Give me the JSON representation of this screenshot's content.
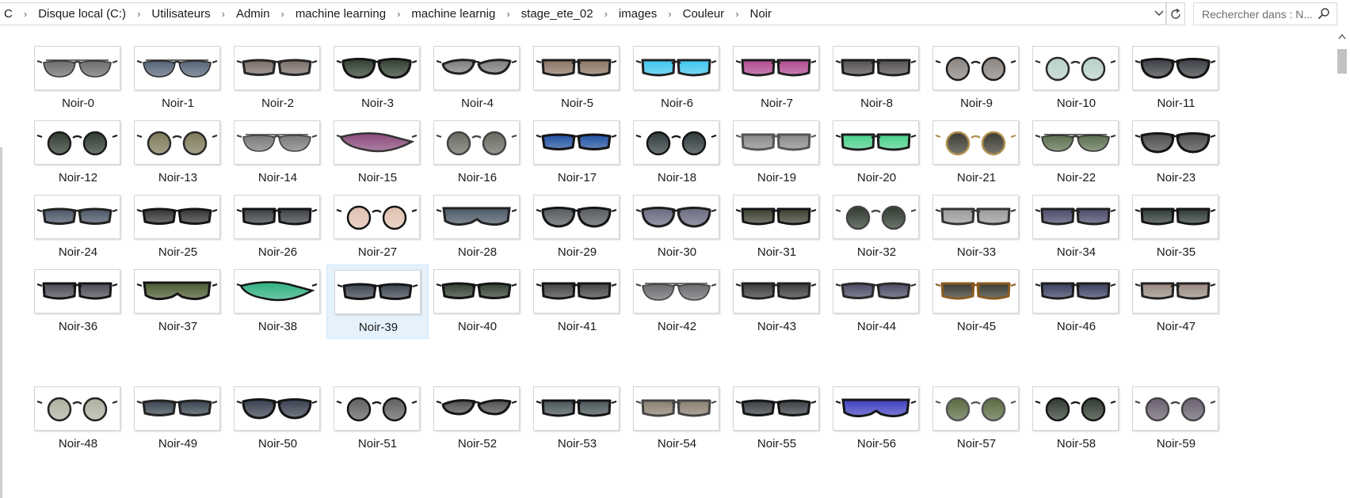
{
  "address_bar": {
    "breadcrumbs": [
      "C",
      "Disque local (C:)",
      "Utilisateurs",
      "Admin",
      "machine learning",
      "machine learnig",
      "stage_ete_02",
      "images",
      "Couleur",
      "Noir"
    ]
  },
  "search": {
    "placeholder": "Rechercher dans : N..."
  },
  "icons": {
    "dropdown": "chevron-down-icon",
    "refresh": "refresh-icon",
    "search": "search-icon",
    "separator": "chevron-right-icon",
    "scroll_up": "caret-up-icon"
  },
  "selected_file": "Noir-39",
  "files": [
    {
      "name": "Noir-0",
      "lens": "#6d6d6d",
      "frame": "#3a3a3a",
      "style": "aviator"
    },
    {
      "name": "Noir-1",
      "lens": "#556577",
      "frame": "#2c2c2c",
      "style": "aviator"
    },
    {
      "name": "Noir-2",
      "lens": "#7a6d68",
      "frame": "#262626",
      "style": "wrap"
    },
    {
      "name": "Noir-3",
      "lens": "#2f3f2f",
      "frame": "#151515",
      "style": "cat"
    },
    {
      "name": "Noir-4",
      "lens": "#7d7d7d",
      "frame": "#222222",
      "style": "cateye"
    },
    {
      "name": "Noir-5",
      "lens": "#8a7565",
      "frame": "#1e1e1e",
      "style": "square"
    },
    {
      "name": "Noir-6",
      "lens": "#3fc6f0",
      "frame": "#202020",
      "style": "square"
    },
    {
      "name": "Noir-7",
      "lens": "#b04a90",
      "frame": "#1e1e1e",
      "style": "square"
    },
    {
      "name": "Noir-8",
      "lens": "#555050",
      "frame": "#1e1e1e",
      "style": "square"
    },
    {
      "name": "Noir-9",
      "lens": "#8a8480",
      "frame": "#1e1e1e",
      "style": "round"
    },
    {
      "name": "Noir-10",
      "lens": "#b8d0c8",
      "frame": "#2a2a2a",
      "style": "round"
    },
    {
      "name": "Noir-11",
      "lens": "#3b3f44",
      "frame": "#151515",
      "style": "cat"
    },
    {
      "name": "Noir-12",
      "lens": "#2f3a2f",
      "frame": "#1b1b1b",
      "style": "round"
    },
    {
      "name": "Noir-13",
      "lens": "#7e7a5a",
      "frame": "#2a2a2a",
      "style": "round"
    },
    {
      "name": "Noir-14",
      "lens": "#7a7a7a",
      "frame": "#444444",
      "style": "aviator"
    },
    {
      "name": "Noir-15",
      "lens": "#8a4a7a",
      "frame": "#333333",
      "style": "sport"
    },
    {
      "name": "Noir-16",
      "lens": "#6a6a62",
      "frame": "#444444",
      "style": "round"
    },
    {
      "name": "Noir-17",
      "lens": "#2050a0",
      "frame": "#151515",
      "style": "wrap"
    },
    {
      "name": "Noir-18",
      "lens": "#2e3a3c",
      "frame": "#151515",
      "style": "round"
    },
    {
      "name": "Noir-19",
      "lens": "#8a8a8a",
      "frame": "#555555",
      "style": "square"
    },
    {
      "name": "Noir-20",
      "lens": "#4ad08a",
      "frame": "#1e1e1e",
      "style": "square"
    },
    {
      "name": "Noir-21",
      "lens": "#3a3a30",
      "frame": "#b09050",
      "style": "round"
    },
    {
      "name": "Noir-22",
      "lens": "#5a7050",
      "frame": "#333333",
      "style": "aviator"
    },
    {
      "name": "Noir-23",
      "lens": "#4a4a4a",
      "frame": "#151515",
      "style": "cat"
    },
    {
      "name": "Noir-24",
      "lens": "#4a5566",
      "frame": "#222222",
      "style": "wrap"
    },
    {
      "name": "Noir-25",
      "lens": "#333333",
      "frame": "#151515",
      "style": "wrap"
    },
    {
      "name": "Noir-26",
      "lens": "#3c3f44",
      "frame": "#151515",
      "style": "square"
    },
    {
      "name": "Noir-27",
      "lens": "#e0c0b0",
      "frame": "#151515",
      "style": "round"
    },
    {
      "name": "Noir-28",
      "lens": "#4a5866",
      "frame": "#222222",
      "style": "shield"
    },
    {
      "name": "Noir-29",
      "lens": "#555a60",
      "frame": "#151515",
      "style": "cat"
    },
    {
      "name": "Noir-30",
      "lens": "#6a6a80",
      "frame": "#1e1e1e",
      "style": "cat"
    },
    {
      "name": "Noir-31",
      "lens": "#3a4030",
      "frame": "#151515",
      "style": "square"
    },
    {
      "name": "Noir-32",
      "lens": "#2f3a2f",
      "frame": "#444444",
      "style": "round"
    },
    {
      "name": "Noir-33",
      "lens": "#9a9a9a",
      "frame": "#333333",
      "style": "square"
    },
    {
      "name": "Noir-34",
      "lens": "#4a4a6a",
      "frame": "#222222",
      "style": "square"
    },
    {
      "name": "Noir-35",
      "lens": "#2f3a33",
      "frame": "#151515",
      "style": "square"
    },
    {
      "name": "Noir-36",
      "lens": "#4a4a55",
      "frame": "#151515",
      "style": "square"
    },
    {
      "name": "Noir-37",
      "lens": "#4a5a30",
      "frame": "#151515",
      "style": "shield"
    },
    {
      "name": "Noir-38",
      "lens": "#30b080",
      "frame": "#151515",
      "style": "sport"
    },
    {
      "name": "Noir-39",
      "lens": "#3c4450",
      "frame": "#151515",
      "style": "wrap"
    },
    {
      "name": "Noir-40",
      "lens": "#2f3f2f",
      "frame": "#151515",
      "style": "wrap"
    },
    {
      "name": "Noir-41",
      "lens": "#444444",
      "frame": "#151515",
      "style": "square"
    },
    {
      "name": "Noir-42",
      "lens": "#6a6a70",
      "frame": "#444444",
      "style": "aviator"
    },
    {
      "name": "Noir-43",
      "lens": "#3a3a3a",
      "frame": "#222222",
      "style": "square"
    },
    {
      "name": "Noir-44",
      "lens": "#4a4a66",
      "frame": "#2a2a2a",
      "style": "wrap"
    },
    {
      "name": "Noir-45",
      "lens": "#3a3a30",
      "frame": "#8a5a20",
      "style": "square"
    },
    {
      "name": "Noir-46",
      "lens": "#3a4060",
      "frame": "#1e1e1e",
      "style": "square"
    },
    {
      "name": "Noir-47",
      "lens": "#9a8a80",
      "frame": "#222222",
      "style": "square"
    },
    {
      "name": "Noir-48",
      "lens": "#b0b0a0",
      "frame": "#222222",
      "style": "round"
    },
    {
      "name": "Noir-49",
      "lens": "#3a4450",
      "frame": "#222222",
      "style": "wrap"
    },
    {
      "name": "Noir-50",
      "lens": "#3a4050",
      "frame": "#151515",
      "style": "cat"
    },
    {
      "name": "Noir-51",
      "lens": "#606060",
      "frame": "#151515",
      "style": "round"
    },
    {
      "name": "Noir-52",
      "lens": "#505050",
      "frame": "#151515",
      "style": "cateye"
    },
    {
      "name": "Noir-53",
      "lens": "#4a5458",
      "frame": "#151515",
      "style": "square"
    },
    {
      "name": "Noir-54",
      "lens": "#8a8070",
      "frame": "#444444",
      "style": "square"
    },
    {
      "name": "Noir-55",
      "lens": "#3a3f44",
      "frame": "#151515",
      "style": "wrap"
    },
    {
      "name": "Noir-56",
      "lens": "#4040c0",
      "frame": "#151515",
      "style": "shield"
    },
    {
      "name": "Noir-57",
      "lens": "#5a6a40",
      "frame": "#555555",
      "style": "round"
    },
    {
      "name": "Noir-58",
      "lens": "#303a30",
      "frame": "#151515",
      "style": "round"
    },
    {
      "name": "Noir-59",
      "lens": "#6a6070",
      "frame": "#444444",
      "style": "round"
    }
  ]
}
